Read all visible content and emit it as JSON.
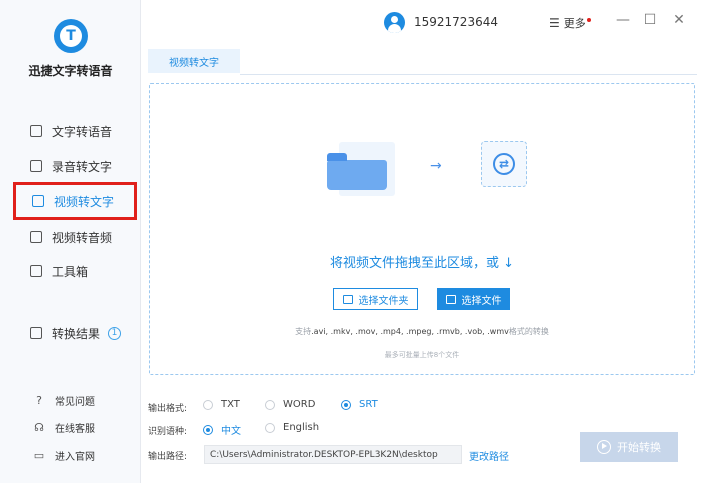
{
  "app": {
    "name": "迅捷文字转语音"
  },
  "sidebar": {
    "items": [
      {
        "label": "文字转语音",
        "icon": "text-icon"
      },
      {
        "label": "录音转文字",
        "icon": "record-icon"
      },
      {
        "label": "视频转文字",
        "icon": "video-text-icon",
        "active": true
      },
      {
        "label": "视频转音频",
        "icon": "video-audio-icon"
      },
      {
        "label": "工具箱",
        "icon": "toolbox-icon"
      }
    ],
    "results": {
      "label": "转换结果",
      "count": "1"
    },
    "help": [
      {
        "label": "常见问题",
        "icon": "question-icon"
      },
      {
        "label": "在线客服",
        "icon": "headset-icon"
      },
      {
        "label": "进入官网",
        "icon": "monitor-icon"
      }
    ]
  },
  "header": {
    "phone": "15921723644",
    "more_label": "更多"
  },
  "tabs": [
    {
      "label": "视频转文字"
    }
  ],
  "dropzone": {
    "text": "将视频文件拖拽至此区域，或 ↓",
    "select_folder": "选择文件夹",
    "select_file": "选择文件",
    "formats_prefix": "支持",
    "formats_list": ".avi, .mkv, .mov, .mp4, .mpeg, .rmvb, .vob, .wmv",
    "formats_suffix": "格式的转换",
    "limit": "最多可批量上传8个文件"
  },
  "options": {
    "format_label": "输出格式:",
    "formats": [
      {
        "label": "TXT",
        "checked": false
      },
      {
        "label": "WORD",
        "checked": false
      },
      {
        "label": "SRT",
        "checked": true
      }
    ],
    "lang_label": "识别语种:",
    "languages": [
      {
        "label": "中文",
        "checked": true
      },
      {
        "label": "English",
        "checked": false
      }
    ],
    "path_label": "输出路径:",
    "path": "C:\\Users\\Administrator.DESKTOP-EPL3K2N\\desktop",
    "change_path": "更改路径"
  },
  "start_button": "开始转换"
}
